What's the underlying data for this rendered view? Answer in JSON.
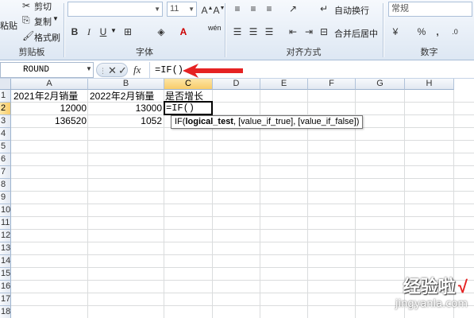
{
  "ribbon": {
    "clipboard": {
      "paste": "粘贴",
      "cut": "剪切",
      "copy": "复制",
      "format_painter": "格式刷",
      "label": "剪贴板"
    },
    "font": {
      "font_size": "11",
      "bold": "B",
      "italic": "I",
      "underline": "U",
      "wen": "wén",
      "label": "字体"
    },
    "alignment": {
      "wrap_text": "自动换行",
      "merge_center": "合并后居中",
      "label": "对齐方式"
    },
    "number": {
      "format": "常规",
      "percent": "%",
      "comma": ",",
      "label": "数字"
    }
  },
  "formula_bar": {
    "name_box": "ROUND",
    "cancel_icon": "✕",
    "enter_icon": "✓",
    "fx": "fx",
    "formula": "=IF()"
  },
  "grid": {
    "columns": [
      "A",
      "B",
      "C",
      "D",
      "E",
      "F",
      "G",
      "H"
    ],
    "selected_column": "C",
    "rows": [
      "1",
      "2",
      "3",
      "4",
      "5",
      "6",
      "7",
      "8",
      "9",
      "10",
      "11",
      "12",
      "13",
      "14",
      "15",
      "16",
      "17",
      "18"
    ],
    "selected_row": "2",
    "cells": {
      "A1": "2021年2月销量",
      "B1": "2022年2月销量",
      "C1": "是否增长",
      "A2": "12000",
      "B2": "13000",
      "C2": "=IF()",
      "A3": "136520",
      "B3": "1052"
    }
  },
  "tooltip": {
    "func": "IF(",
    "arg1": "logical_test",
    "rest": ", [value_if_true], [value_if_false])"
  },
  "watermark": {
    "cn": "经验啦",
    "check": "√",
    "url": "jingyanla.com"
  },
  "colors": {
    "accent_arrow": "#e52222",
    "selected_header": "#f8cc6a",
    "ribbon_bg": "#dde7f3"
  }
}
